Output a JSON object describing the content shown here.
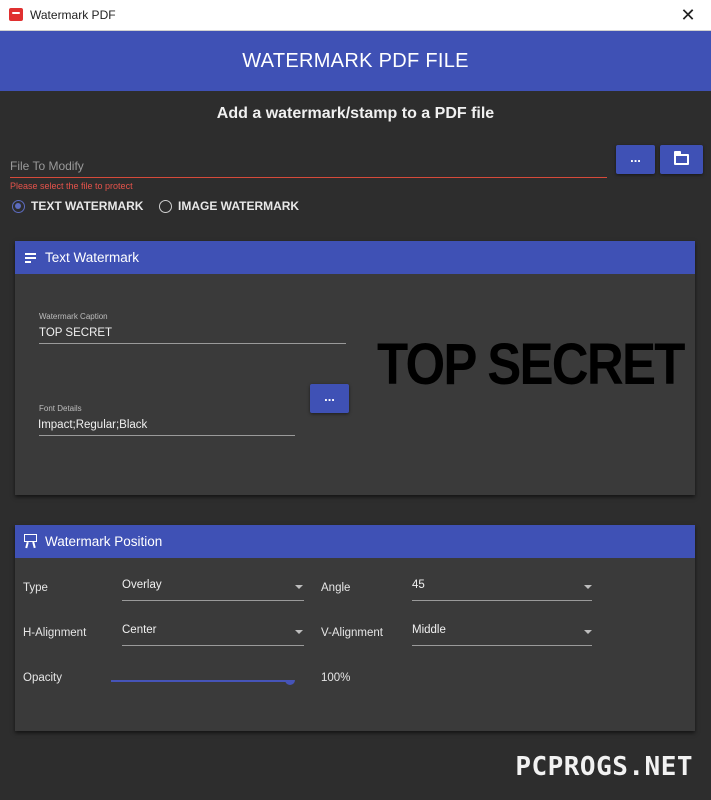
{
  "window": {
    "title": "Watermark PDF",
    "close_glyph": "✕"
  },
  "header": {
    "title": "WATERMARK PDF FILE"
  },
  "subtitle": "Add a watermark/stamp to a PDF file",
  "file": {
    "label": "File To Modify",
    "error": "Please select the file to protect",
    "browse_label": "...",
    "folder_icon": "folder-icon"
  },
  "mode": {
    "options": [
      "TEXT WATERMARK",
      "IMAGE WATERMARK"
    ],
    "selected": "TEXT WATERMARK"
  },
  "text_watermark": {
    "header": "Text Watermark",
    "caption_label": "Watermark Caption",
    "caption_value": "TOP SECRET",
    "font_label": "Font Details",
    "font_value": "Impact;Regular;Black",
    "font_button": "...",
    "preview": "TOP SECRET"
  },
  "position": {
    "header": "Watermark Position",
    "type_label": "Type",
    "type_value": "Overlay",
    "angle_label": "Angle",
    "angle_value": "45",
    "halign_label": "H-Alignment",
    "halign_value": "Center",
    "valign_label": "V-Alignment",
    "valign_value": "Middle",
    "opacity_label": "Opacity",
    "opacity_value": "100%",
    "opacity_fraction": 1.0
  },
  "site_watermark": "PCPROGS.NET",
  "colors": {
    "accent": "#3f51b5",
    "background": "#2d2d2d",
    "card": "#3a3a3a",
    "error": "#e5534b"
  }
}
